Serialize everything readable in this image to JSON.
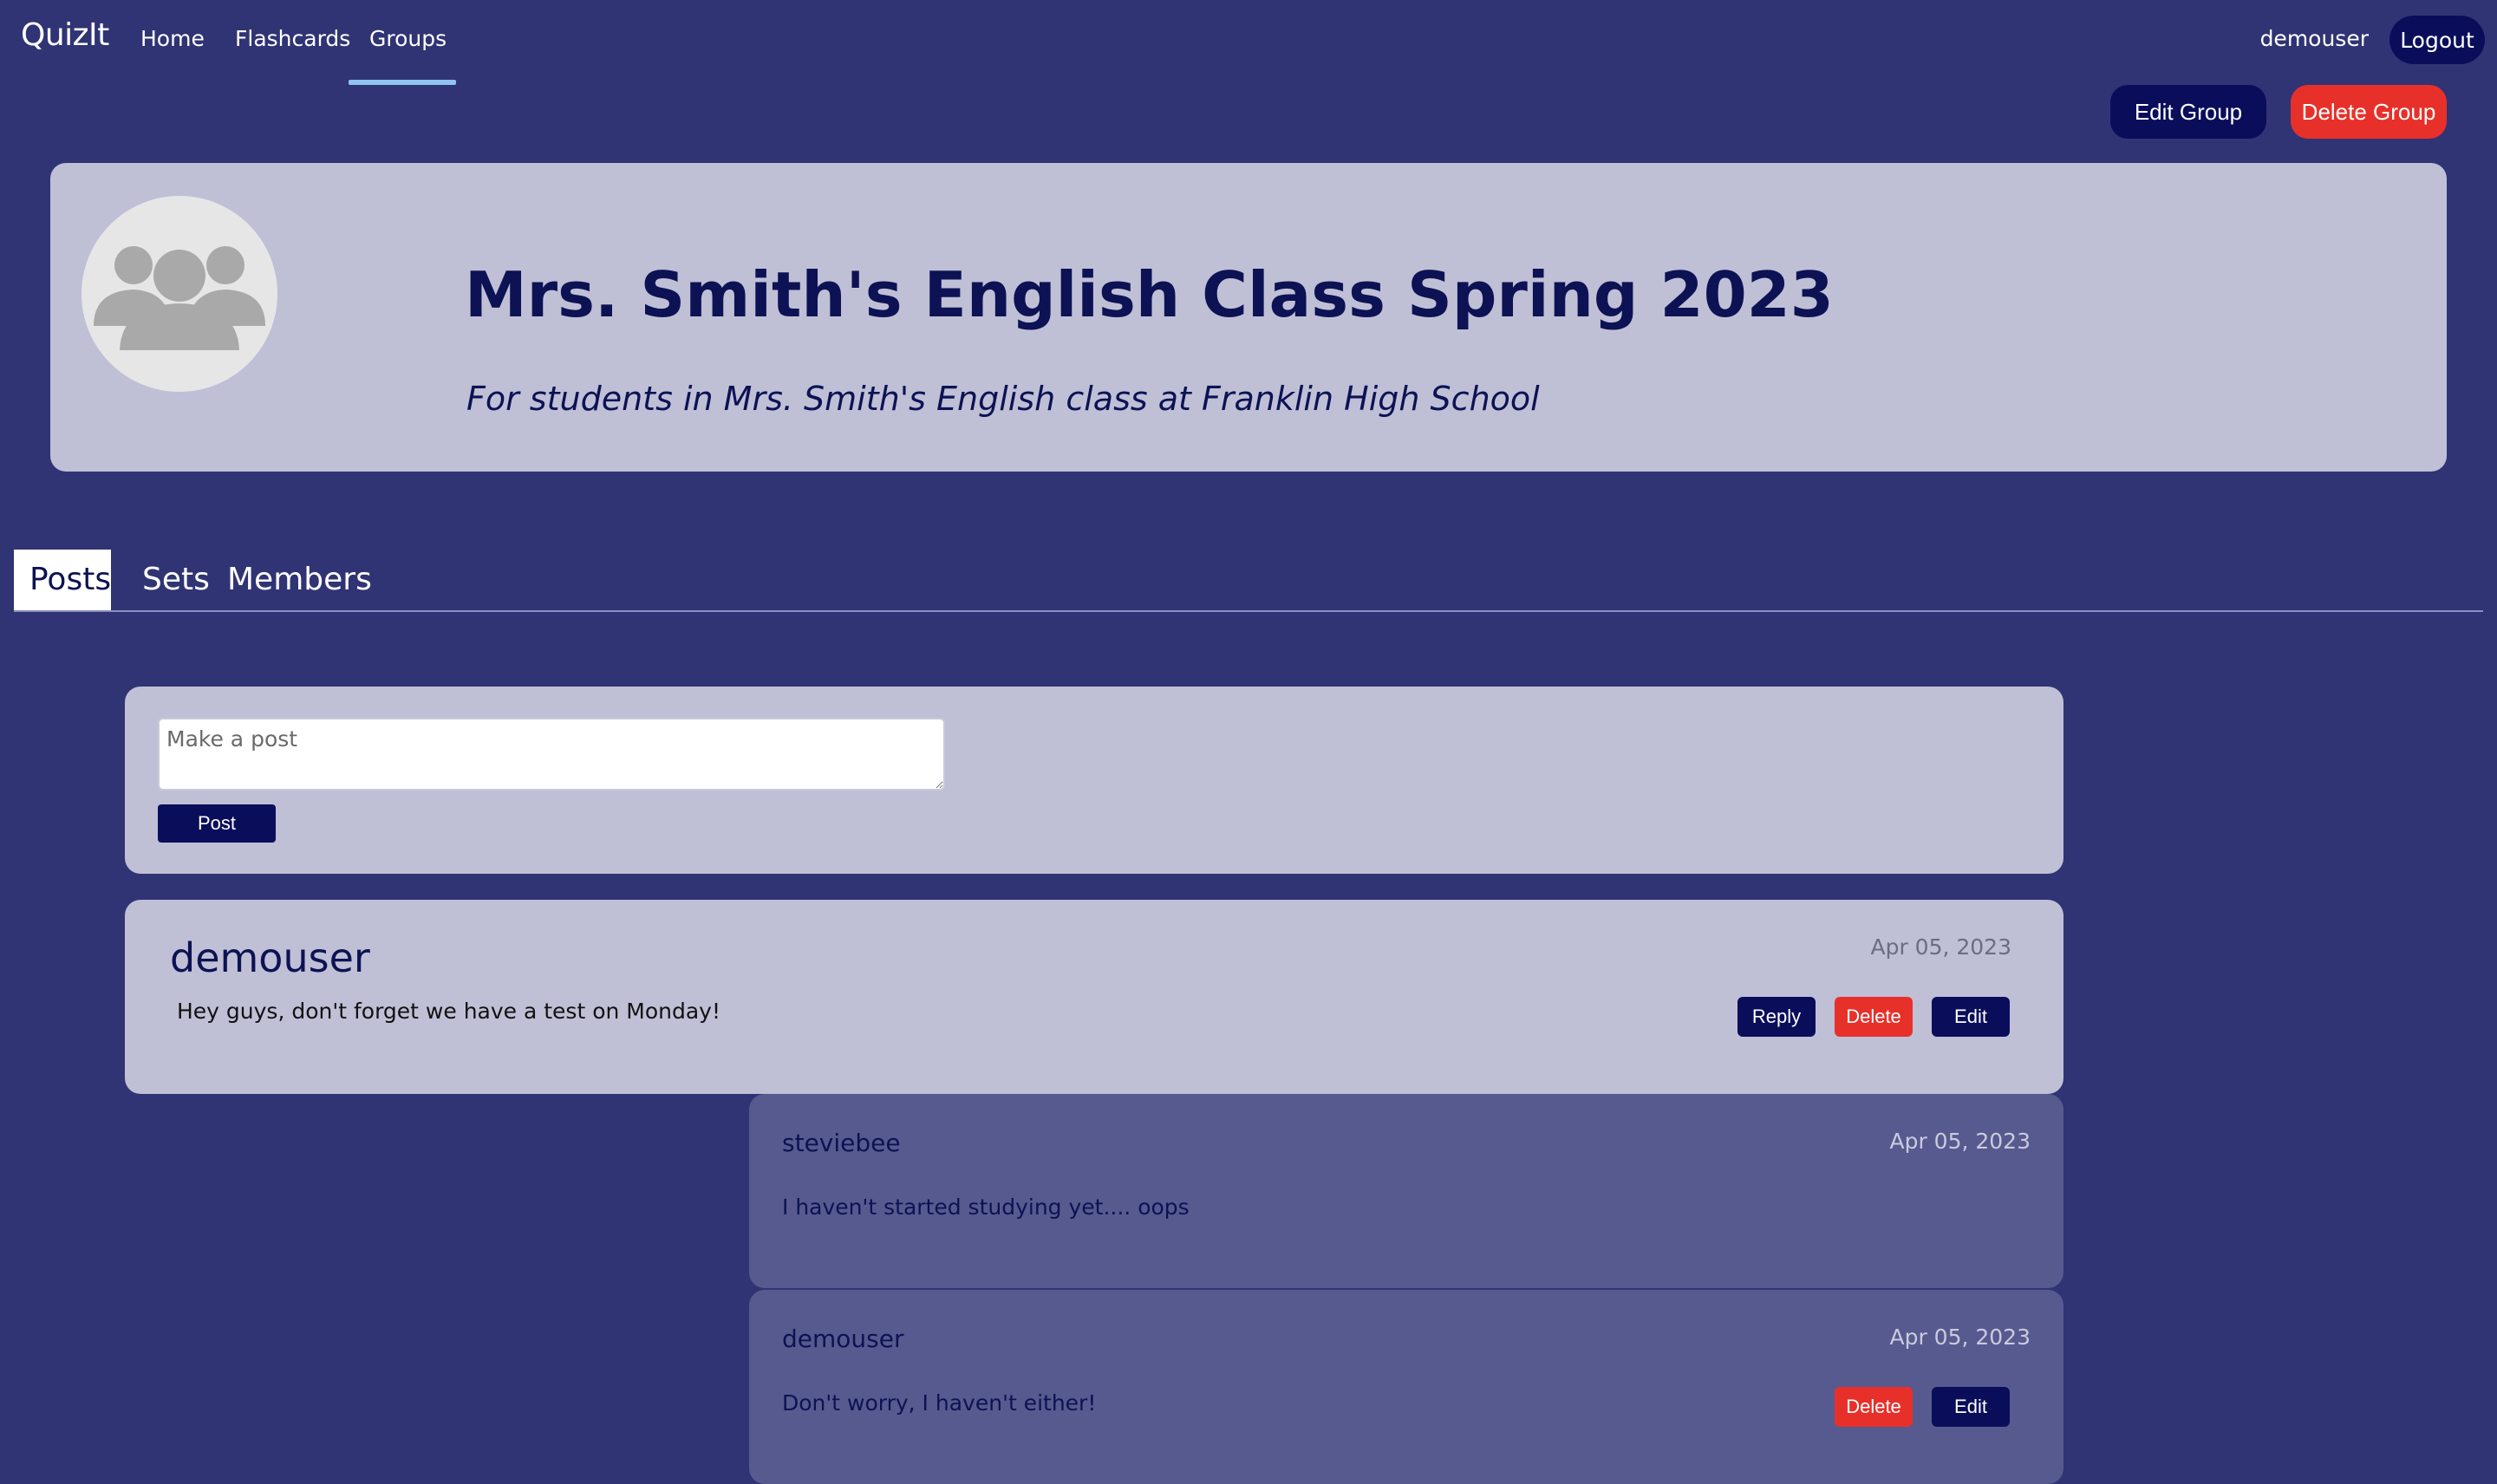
{
  "navbar": {
    "brand": "QuizIt",
    "links": [
      {
        "label": "Home"
      },
      {
        "label": "Flashcards"
      },
      {
        "label": "Groups",
        "active": true
      }
    ],
    "username": "demouser",
    "logout_label": "Logout"
  },
  "group_actions": {
    "edit_label": "Edit Group",
    "delete_label": "Delete Group"
  },
  "group": {
    "title": "Mrs. Smith's English Class Spring 2023",
    "description": "For students in Mrs. Smith's English class at Franklin High School",
    "avatar_icon": "group-people-icon"
  },
  "tabs": [
    {
      "label": "Posts",
      "active": true
    },
    {
      "label": "Sets"
    },
    {
      "label": "Members"
    }
  ],
  "composer": {
    "placeholder": "Make a post",
    "submit_label": "Post"
  },
  "posts": [
    {
      "author": "demouser",
      "date": "Apr 05, 2023",
      "body": "Hey guys, don't forget we have a test on Monday!",
      "actions": {
        "reply": "Reply",
        "delete": "Delete",
        "edit": "Edit"
      },
      "replies": [
        {
          "author": "steviebee",
          "date": "Apr 05, 2023",
          "body": "I haven't started studying yet.... oops"
        },
        {
          "author": "demouser",
          "date": "Apr 05, 2023",
          "body": "Don't worry, I haven't either!",
          "actions": {
            "delete": "Delete",
            "edit": "Edit"
          }
        }
      ]
    }
  ],
  "colors": {
    "background": "#303474",
    "card": "#bfc0d6",
    "reply_card": "#575a8e",
    "navy": "#0a0e5a",
    "danger": "#e8302a",
    "accent": "#8fc3f2"
  }
}
